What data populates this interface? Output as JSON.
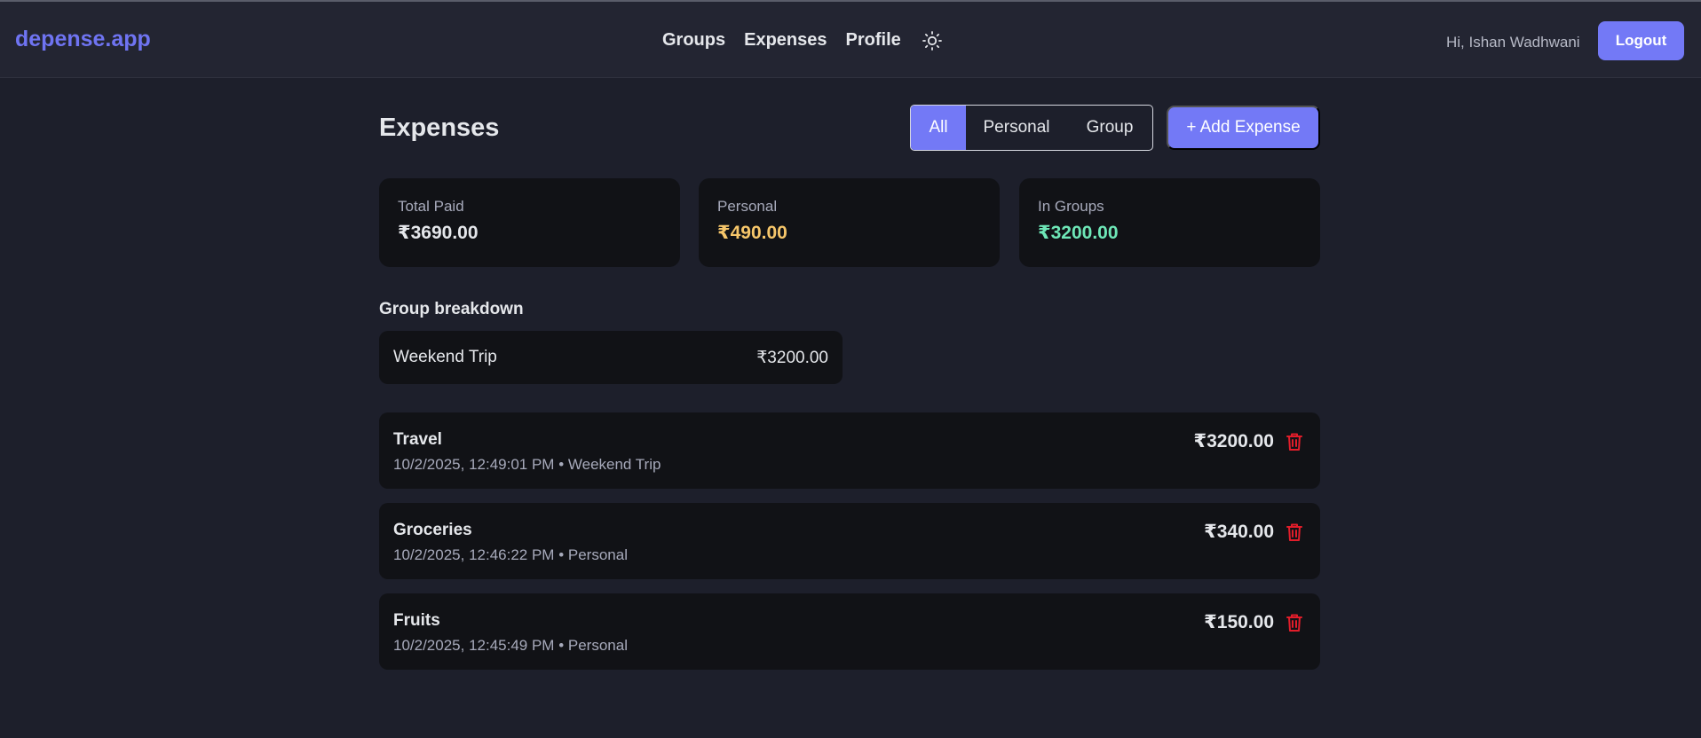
{
  "app": {
    "brand": "depense.app"
  },
  "nav": {
    "links": [
      "Groups",
      "Expenses",
      "Profile"
    ],
    "theme_icon": "sun-icon",
    "greeting": "Hi, Ishan Wadhwani",
    "logout_label": "Logout"
  },
  "page": {
    "title": "Expenses",
    "filters": {
      "all": "All",
      "personal": "Personal",
      "group": "Group",
      "selected": "All"
    },
    "add_label": "+ Add Expense"
  },
  "stats": [
    {
      "label": "Total Paid",
      "value": "₹3690.00",
      "color": "#e5e7eb"
    },
    {
      "label": "Personal",
      "value": "₹490.00",
      "color": "#f6c66a"
    },
    {
      "label": "In Groups",
      "value": "₹3200.00",
      "color": "#6ee7b7"
    }
  ],
  "breakdown": {
    "title": "Group breakdown",
    "groups": [
      {
        "name": "Weekend Trip",
        "amount": "₹3200.00"
      }
    ]
  },
  "expenses": [
    {
      "title": "Travel",
      "meta": "10/2/2025, 12:49:01 PM • Weekend Trip",
      "amount": "₹3200.00"
    },
    {
      "title": "Groceries",
      "meta": "10/2/2025, 12:46:22 PM • Personal",
      "amount": "₹340.00"
    },
    {
      "title": "Fruits",
      "meta": "10/2/2025, 12:45:49 PM • Personal",
      "amount": "₹150.00"
    }
  ],
  "colors": {
    "accent": "#7379f6",
    "danger": "#e11d2a",
    "background": "#1d1f2b",
    "card": "#111216"
  }
}
